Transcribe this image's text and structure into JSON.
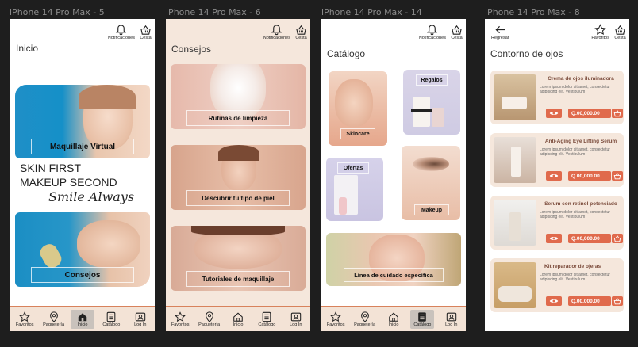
{
  "frames": [
    {
      "label": "iPhone 14 Pro Max - 5"
    },
    {
      "label": "iPhone 14 Pro Max - 6"
    },
    {
      "label": "iPhone 14 Pro Max - 14"
    },
    {
      "label": "iPhone 14 Pro Max - 8"
    }
  ],
  "topbar": {
    "notifications": "Notificaciones",
    "cart": "Cesta",
    "favorites": "Favoritos"
  },
  "screen_inicio": {
    "title": "Inicio",
    "banner1": "Maquillaje Virtual",
    "tagline1": "SKIN FIRST",
    "tagline2": "MAKEUP SECOND",
    "tagline3": "Smile Always",
    "banner2": "Consejos"
  },
  "screen_consejos": {
    "title": "Consejos",
    "cards": [
      "Rutinas de limpieza",
      "Descubrir tu tipo de piel",
      "Tutoriales de maquillaje"
    ]
  },
  "screen_catalogo": {
    "title": "Catálogo",
    "tiles": [
      "Skincare",
      "Regalos",
      "Ofertas",
      "Makeup",
      "Línea de cuidado específica"
    ]
  },
  "screen_contorno": {
    "back": "Regresar",
    "title": "Contorno de ojos",
    "desc": "Lorem ipsum dolor sit amet, consectetur adipiscing elit. Vestibulum",
    "products": [
      {
        "name": "Crema de ojos iluminadora",
        "price": "Q.00,000.00"
      },
      {
        "name": "Anti-Aging Eye Lifting Serum",
        "price": "Q.00,000.00"
      },
      {
        "name": "Serum con retinol potenciado",
        "price": "Q.00,000.00"
      },
      {
        "name": "Kit reparador de ojeras",
        "price": "Q.00,000.00"
      }
    ]
  },
  "nav": [
    "Favoritos",
    "Paquetería",
    "Inicio",
    "Catálogo",
    "Log In"
  ],
  "colors": {
    "accent": "#e06a4c",
    "cream": "#f5e7dc",
    "navbar_border": "#d8825c"
  }
}
